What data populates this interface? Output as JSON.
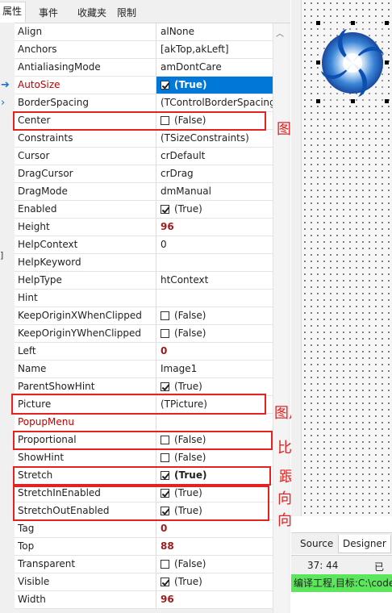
{
  "tabs": [
    "属性",
    "事件",
    "收藏夹",
    "限制"
  ],
  "properties": [
    {
      "name": "Align",
      "value": "alNone"
    },
    {
      "name": "Anchors",
      "value": "[akTop,akLeft]"
    },
    {
      "name": "AntialiasingMode",
      "value": "amDontCare"
    },
    {
      "name": "AutoSize",
      "value": "(True)",
      "checkbox": true,
      "checked": true,
      "selected": true
    },
    {
      "name": "BorderSpacing",
      "value": "(TControlBorderSpacing)"
    },
    {
      "name": "Center",
      "value": "(False)",
      "checkbox": true,
      "checked": false
    },
    {
      "name": "Constraints",
      "value": "(TSizeConstraints)"
    },
    {
      "name": "Cursor",
      "value": "crDefault"
    },
    {
      "name": "DragCursor",
      "value": "crDrag"
    },
    {
      "name": "DragMode",
      "value": "dmManual"
    },
    {
      "name": "Enabled",
      "value": "(True)",
      "checkbox": true,
      "checked": true
    },
    {
      "name": "Height",
      "value": "96",
      "numeric": true
    },
    {
      "name": "HelpContext",
      "value": "0"
    },
    {
      "name": "HelpKeyword",
      "value": ""
    },
    {
      "name": "HelpType",
      "value": "htContext"
    },
    {
      "name": "Hint",
      "value": ""
    },
    {
      "name": "KeepOriginXWhenClipped",
      "value": "(False)",
      "checkbox": true,
      "checked": false
    },
    {
      "name": "KeepOriginYWhenClipped",
      "value": "(False)",
      "checkbox": true,
      "checked": false
    },
    {
      "name": "Left",
      "value": "0",
      "numeric": true
    },
    {
      "name": "Name",
      "value": "Image1"
    },
    {
      "name": "ParentShowHint",
      "value": "(True)",
      "checkbox": true,
      "checked": true
    },
    {
      "name": "Picture",
      "value": "(TPicture)"
    },
    {
      "name": "PopupMenu",
      "value": "",
      "red": true
    },
    {
      "name": "Proportional",
      "value": "(False)",
      "checkbox": true,
      "checked": false
    },
    {
      "name": "ShowHint",
      "value": "(False)",
      "checkbox": true,
      "checked": false
    },
    {
      "name": "Stretch",
      "value": "(True)",
      "checkbox": true,
      "checked": true,
      "bold": true
    },
    {
      "name": "StretchInEnabled",
      "value": "(True)",
      "checkbox": true,
      "checked": true
    },
    {
      "name": "StretchOutEnabled",
      "value": "(True)",
      "checkbox": true,
      "checked": true
    },
    {
      "name": "Tag",
      "value": "0",
      "numeric": true
    },
    {
      "name": "Top",
      "value": "88",
      "numeric": true
    },
    {
      "name": "Transparent",
      "value": "(False)",
      "checkbox": true,
      "checked": false
    },
    {
      "name": "Visible",
      "value": "(True)",
      "checkbox": true,
      "checked": true
    },
    {
      "name": "Width",
      "value": "96",
      "numeric": true
    }
  ],
  "annotations": {
    "center": "图像居中",
    "picture": "图片文件",
    "proportional": "比例锁定",
    "stretch": "跟随缩放",
    "stretch_in": "向内缩放",
    "stretch_out": "向外缩放"
  },
  "bottom_tabs": [
    "Source",
    "Designer"
  ],
  "status": {
    "position": "37:  44",
    "state": "已经"
  },
  "message": "编译工程,目标:C:\\code",
  "colors": {
    "accent": "#0078d7",
    "annotation": "#e32222",
    "numeric": "#9b1c1c",
    "message_bg": "#5ce65c"
  }
}
